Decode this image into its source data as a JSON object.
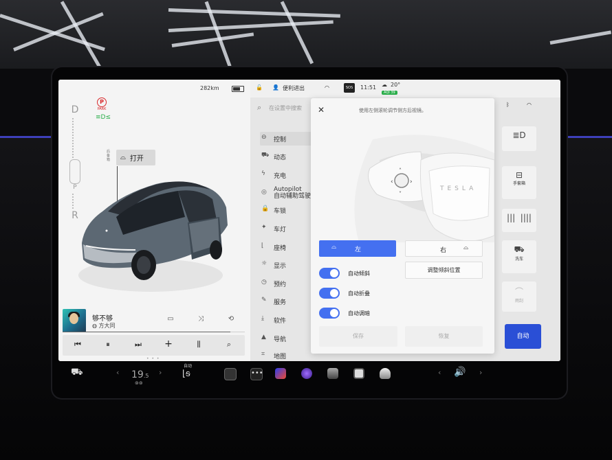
{
  "status": {
    "range": "282km",
    "profile": "便利进出",
    "sos": "SOS",
    "time": "11:51",
    "temperature": "20°",
    "aqi": "AQI 39"
  },
  "drive": {
    "gears": [
      "D",
      "P",
      "R"
    ],
    "park_label": "PARK",
    "park_letter": "P",
    "lights_label": "≡D≤"
  },
  "trunk": {
    "label": "后备箱",
    "open_button": "打开"
  },
  "media": {
    "song": "够不够",
    "artist": "方大同",
    "progress": 0.92
  },
  "search": {
    "placeholder": "在设置中搜索"
  },
  "menu": [
    {
      "icon": "toggle-icon",
      "label": "控制",
      "selected": true
    },
    {
      "icon": "car-icon",
      "label": "动态"
    },
    {
      "icon": "bolt-icon",
      "label": "充电"
    },
    {
      "icon": "wheel-icon",
      "label": "Autopilot",
      "label2": "自动辅助驾驶"
    },
    {
      "icon": "lock-icon",
      "label": "车锁"
    },
    {
      "icon": "light-icon",
      "label": "车灯"
    },
    {
      "icon": "seat-icon",
      "label": "座椅"
    },
    {
      "icon": "display-icon",
      "label": "显示"
    },
    {
      "icon": "clock-icon",
      "label": "预约"
    },
    {
      "icon": "wrench-icon",
      "label": "服务"
    },
    {
      "icon": "download-icon",
      "label": "软件"
    },
    {
      "icon": "nav-icon",
      "label": "导航"
    },
    {
      "icon": "map-icon",
      "label": "地图"
    }
  ],
  "tiles": {
    "glovebox": "手套箱",
    "carwash": "洗车",
    "wiper": "雨刮",
    "auto": "自动"
  },
  "modal": {
    "hint": "使用左侧滚轮调节侧方后视镜。",
    "wheel_brand": "TESLA",
    "left_button": "左",
    "right_button": "右",
    "toggles": [
      "自动倾斜",
      "自动折叠",
      "自动调暗"
    ],
    "tilt_button": "调整倾斜位置",
    "save": "保存",
    "restore": "恢复"
  },
  "dock": {
    "temperature": "19",
    "temperature_decimal": ".5",
    "seat_label": "自动"
  },
  "colors": {
    "accent": "#4470f0",
    "auto_button": "#2a4fd6",
    "park_red": "#d9282b",
    "lights_green": "#2aae4a"
  }
}
